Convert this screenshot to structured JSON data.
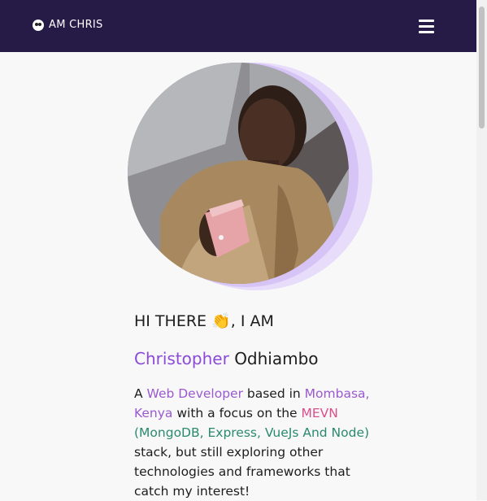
{
  "nav": {
    "brand_text": "AM CHRIS",
    "brand_icon": "panda-icon",
    "menu_icon": "hamburger-menu-icon"
  },
  "hero": {
    "avatar_alt": "Profile photo"
  },
  "intro": {
    "greeting_prefix": "HI THERE",
    "greeting_emoji": "👏",
    "greeting_suffix": ", I AM",
    "first_name": "Christopher",
    "last_name": "Odhiambo",
    "bio_parts": {
      "a": "A ",
      "role": "Web Developer",
      "based": " based in ",
      "location": "Mombasa, Kenya",
      "focus": " with a focus on the ",
      "stack": "MEVN",
      "stack_detail": "(MongoDB, Express, VueJs And Node)",
      "rest": " stack, but still exploring other technologies and frameworks that catch my interest!"
    }
  },
  "colors": {
    "navbar": "#261a47",
    "accent_purple": "#8b4bd8",
    "accent_pink": "#d94f8c",
    "accent_green": "#2a8a6e"
  }
}
